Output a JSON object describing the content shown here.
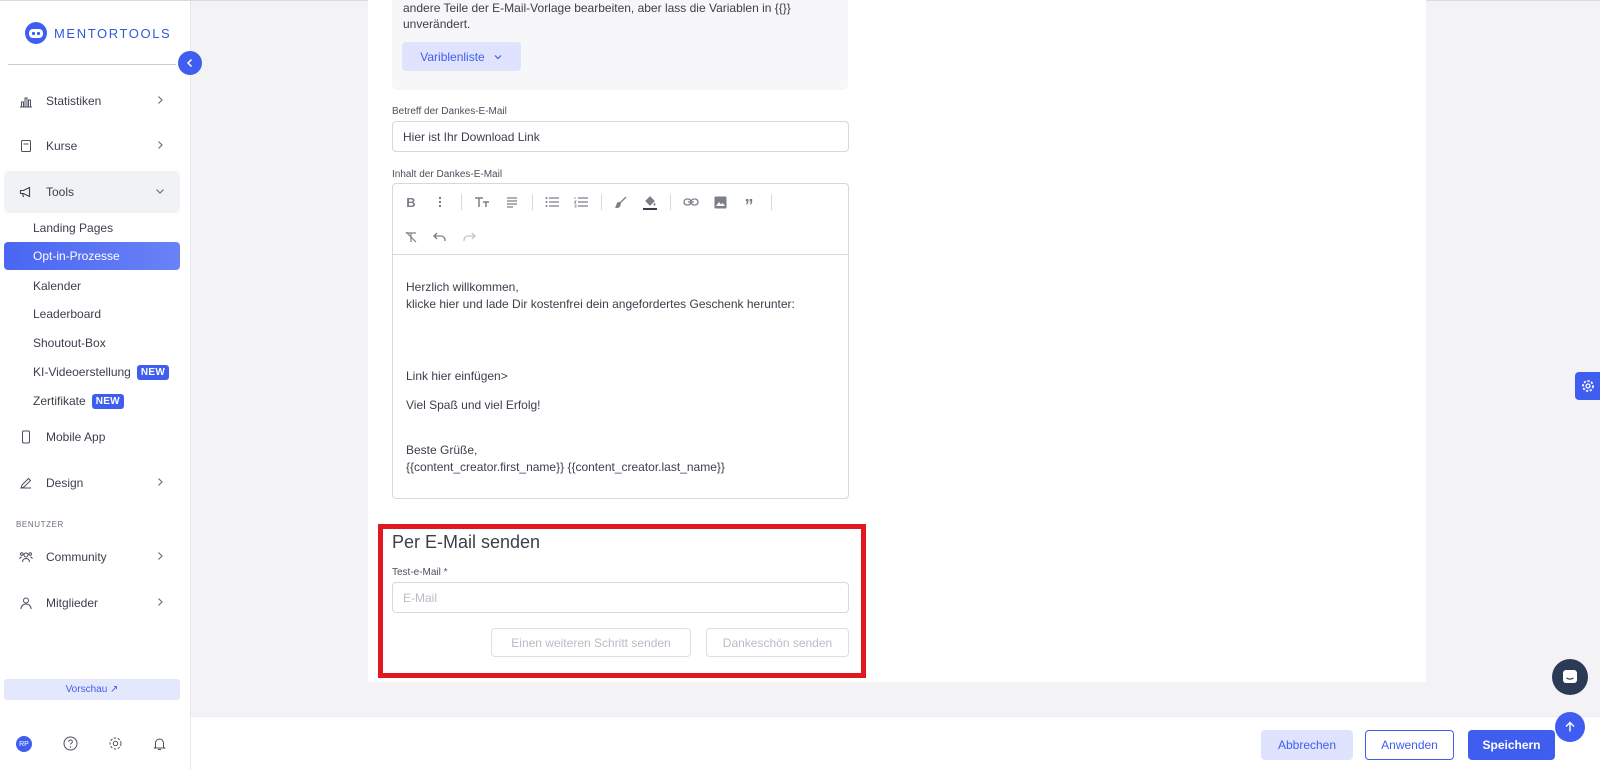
{
  "brand": {
    "name": "MENTORTOOLS"
  },
  "sidebar": {
    "items": [
      {
        "label": "Statistiken"
      },
      {
        "label": "Kurse"
      },
      {
        "label": "Tools"
      },
      {
        "label": "Mobile App"
      },
      {
        "label": "Design"
      },
      {
        "label": "Community"
      },
      {
        "label": "Mitglieder"
      }
    ],
    "tools_sub": [
      {
        "label": "Landing Pages"
      },
      {
        "label": "Opt-in-Prozesse"
      },
      {
        "label": "Kalender"
      },
      {
        "label": "Leaderboard"
      },
      {
        "label": "Shoutout-Box"
      },
      {
        "label": "KI-Videoerstellung",
        "badge": "NEW"
      },
      {
        "label": "Zertifikate",
        "badge": "NEW"
      }
    ],
    "section_users": "BENUTZER",
    "preview_label": "Vorschau ↗",
    "avatar_initials": "RP"
  },
  "info": {
    "text_line1": "andere Teile der E-Mail-Vorlage bearbeiten, aber lass die Variablen in {{}}",
    "text_line2": "unverändert.",
    "variables_button": "Variblenliste"
  },
  "subject": {
    "label": "Betreff der Dankes-E-Mail",
    "value": "Hier ist Ihr Download Link"
  },
  "content": {
    "label": "Inhalt der Dankes-E-Mail",
    "body": [
      "Herzlich willkommen,",
      "klicke hier und lade Dir kostenfrei dein angefordertes Geschenk herunter:",
      "Link hier einfügen>",
      "Viel Spaß und viel Erfolg!",
      "Beste Grüße,",
      "{{content_creator.first_name}} {{content_creator.last_name}}"
    ]
  },
  "send": {
    "title": "Per E-Mail senden",
    "email_label": "Test-e-Mail *",
    "email_placeholder": "E-Mail",
    "another_step_button": "Einen weiteren Schritt senden",
    "thanks_button": "Dankeschön senden"
  },
  "footer": {
    "cancel": "Abbrechen",
    "apply": "Anwenden",
    "save": "Speichern"
  },
  "colors": {
    "accent": "#3f5ef0",
    "highlight": "#e0181f"
  }
}
